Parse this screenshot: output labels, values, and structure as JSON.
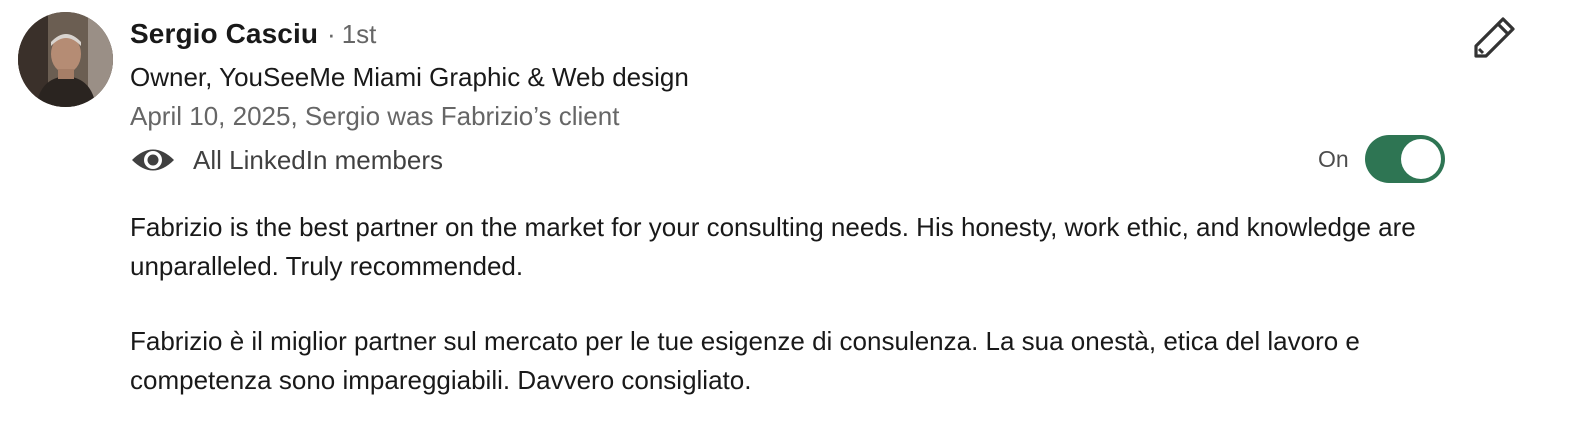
{
  "recommendation": {
    "author_name": "Sergio Casciu",
    "separator": "·",
    "connection_degree": "1st",
    "headline": "Owner, YouSeeMe Miami Graphic & Web design",
    "date_relationship": "April 10, 2025, Sergio was Fabrizio’s client",
    "visibility_icon": "eye-icon",
    "visibility_label": "All LinkedIn members",
    "toggle_label": "On",
    "toggle_state": true,
    "toggle_color": "#2e7553",
    "edit_icon": "pencil-icon",
    "paragraphs": [
      "Fabrizio is the best partner on the market for your consulting needs. His honesty, work ethic, and knowledge are unparalleled. Truly recommended.",
      "Fabrizio è il miglior partner sul mercato per le tue esigenze di consulenza. La sua onestà, etica del lavoro e competenza sono impareggiabili. Davvero consigliato."
    ]
  }
}
